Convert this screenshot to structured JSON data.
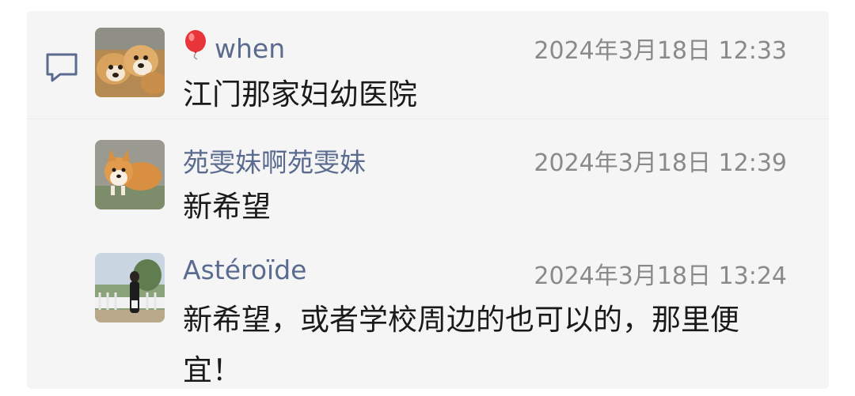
{
  "comments": [
    {
      "username": "when",
      "timestamp": "2024年3月18日 12:33",
      "text": "江门那家妇幼医院",
      "icon": "balloon-icon"
    },
    {
      "username": "苑雯妹啊苑雯妹",
      "timestamp": "2024年3月18日 12:39",
      "text": "新希望"
    },
    {
      "username": "Astéroïde",
      "timestamp": "2024年3月18日 13:24",
      "text": "新希望，或者学校周边的也可以的，那里便宜！"
    }
  ],
  "icons": {
    "reply": "comment-bubble-icon"
  },
  "colors": {
    "username": "#5b6b8f",
    "timestamp": "#8a8a8a",
    "panel_bg": "#f5f5f5"
  }
}
